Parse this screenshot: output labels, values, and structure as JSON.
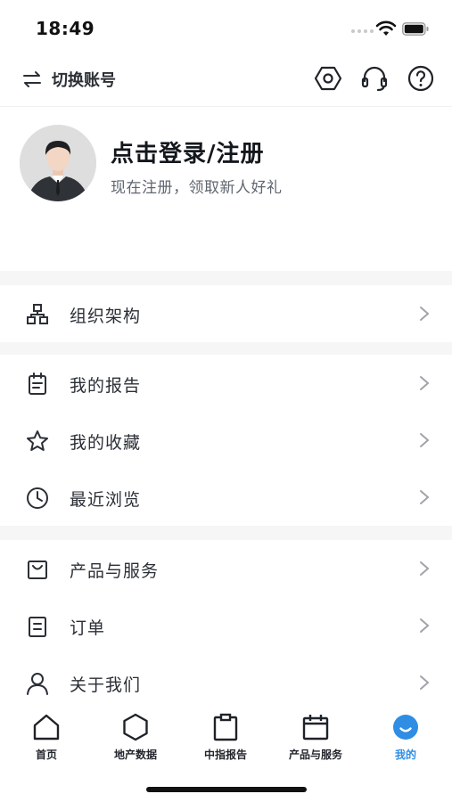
{
  "status_bar": {
    "time": "18:49"
  },
  "header": {
    "switch_account_label": "切换账号"
  },
  "profile": {
    "title": "点击登录/注册",
    "subtitle": "现在注册，领取新人好礼"
  },
  "menu": {
    "org": {
      "label": "组织架构",
      "icon": "org-chart-icon"
    },
    "reports": {
      "label": "我的报告",
      "icon": "report-icon"
    },
    "favorites": {
      "label": "我的收藏",
      "icon": "star-icon"
    },
    "recent": {
      "label": "最近浏览",
      "icon": "clock-icon"
    },
    "products": {
      "label": "产品与服务",
      "icon": "bag-icon"
    },
    "orders": {
      "label": "订单",
      "icon": "order-icon"
    },
    "about": {
      "label": "关于我们",
      "icon": "user-icon"
    }
  },
  "tabs": [
    {
      "label": "首页",
      "icon": "home-icon"
    },
    {
      "label": "地产数据",
      "icon": "hexagon-icon"
    },
    {
      "label": "中指报告",
      "icon": "clipboard-icon"
    },
    {
      "label": "产品与服务",
      "icon": "calendar-icon"
    },
    {
      "label": "我的",
      "icon": "smile-icon",
      "active": true
    }
  ],
  "colors": {
    "accent": "#2f8de4",
    "text": "#2b2f36",
    "divider": "#f6f6f7"
  }
}
